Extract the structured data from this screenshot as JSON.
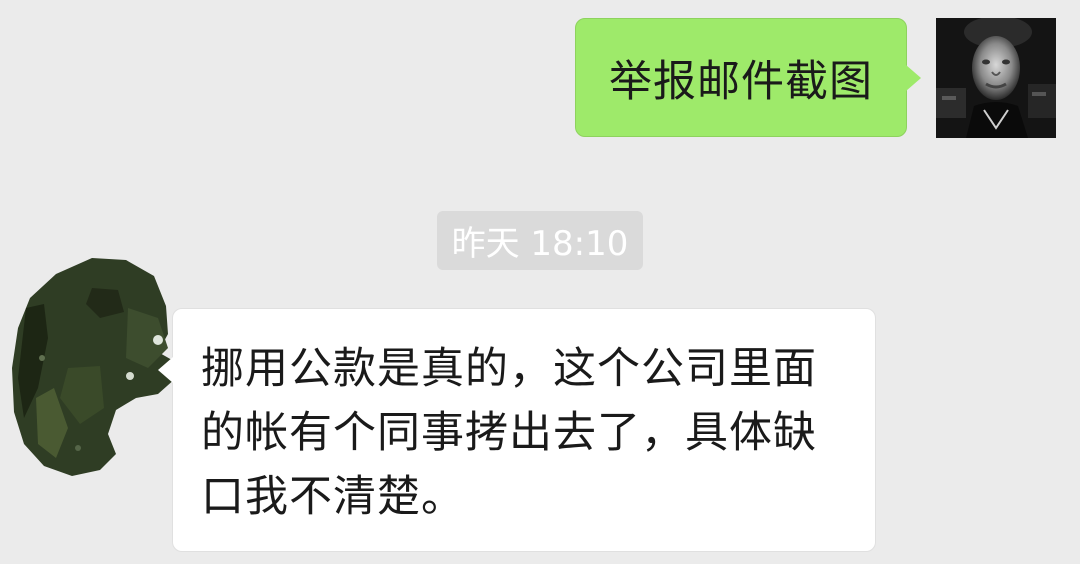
{
  "messages": [
    {
      "direction": "outgoing",
      "text": "举报邮件截图",
      "bubble_color": "#9eea6a",
      "avatar": "user-photo-avatar"
    },
    {
      "direction": "incoming",
      "text": "挪用公款是真的，这个公司里面的帐有个同事拷出去了，具体缺口我不清楚。",
      "bubble_color": "#ffffff",
      "avatar": "blurred-avatar"
    }
  ],
  "timestamp": "昨天 18:10",
  "colors": {
    "background": "#ebebeb",
    "timestamp_bg": "#dadada",
    "timestamp_text": "#ffffff"
  }
}
